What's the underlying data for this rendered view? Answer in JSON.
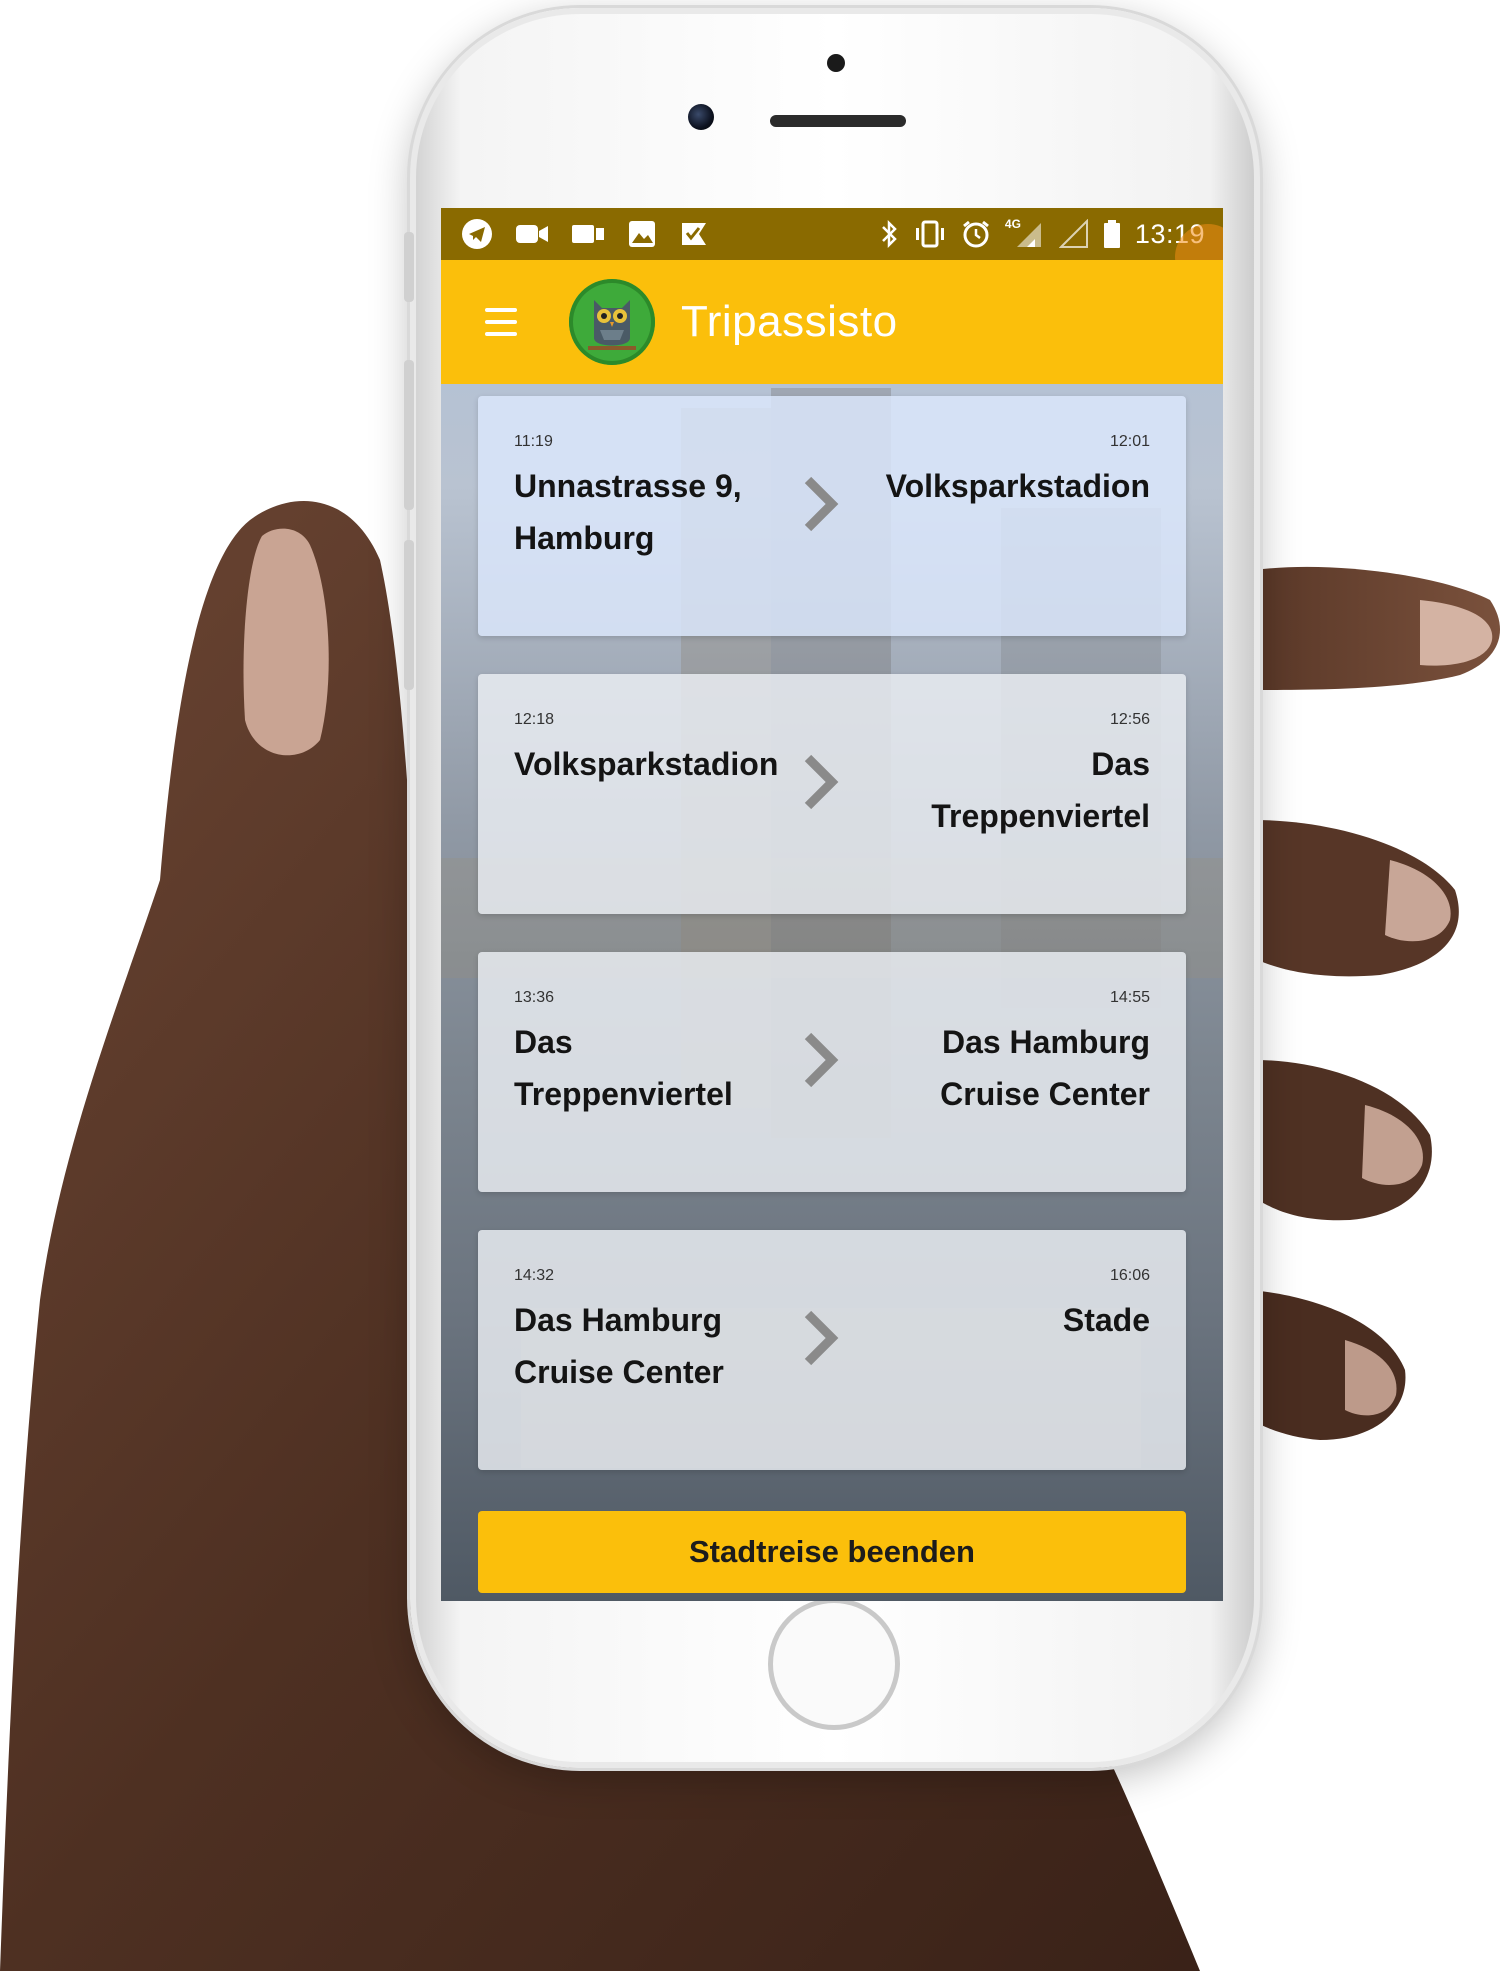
{
  "status_bar": {
    "time": "13:19",
    "network_label": "4G",
    "left_icons": [
      "telegram-icon",
      "video-camera-icon",
      "video-camera-icon",
      "image-icon",
      "task-check-icon"
    ],
    "right_icons": [
      "bluetooth-icon",
      "vibrate-icon",
      "alarm-icon",
      "signal-icon",
      "signal-empty-icon",
      "battery-icon"
    ]
  },
  "app_bar": {
    "title": "Tripassisto",
    "menu_icon": "hamburger-menu-icon",
    "logo_icon": "owl-logo-icon"
  },
  "trips": [
    {
      "departure_time": "11:19",
      "from": "Unnastrasse 9, Hamburg",
      "arrival_time": "12:01",
      "to": "Volksparkstadion"
    },
    {
      "departure_time": "12:18",
      "from": "Volksparkstadion",
      "arrival_time": "12:56",
      "to": "Das Treppenviertel"
    },
    {
      "departure_time": "13:36",
      "from": "Das Treppenviertel",
      "arrival_time": "14:55",
      "to": "Das Hamburg Cruise Center"
    },
    {
      "departure_time": "14:32",
      "from": "Das Hamburg Cruise Center",
      "arrival_time": "16:06",
      "to": "Stade"
    }
  ],
  "end_button_label": "Stadtreise beenden",
  "colors": {
    "accent": "#fbbf0b",
    "status_bar": "#8a6a00",
    "logo_green": "#3eaa3a"
  }
}
